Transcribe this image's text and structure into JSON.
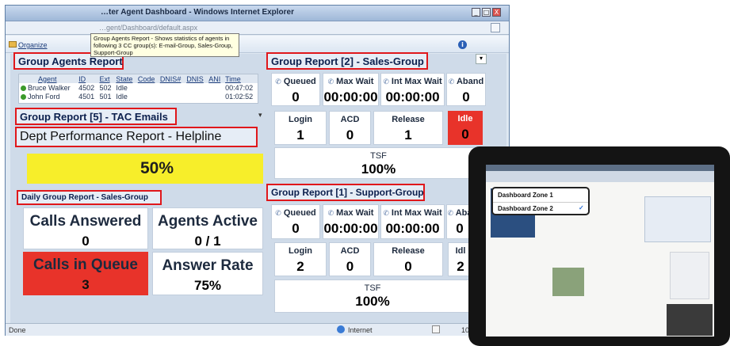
{
  "window": {
    "title": "…ter Agent Dashboard - Windows Internet Explorer",
    "url": "…gent/Dashboard/default.aspx",
    "min": "_",
    "max": "□",
    "close": "X"
  },
  "tooltip": "Group Agents Report - Shows statistics of agents in following 3 CC group(s): E-mail-Group, Sales-Group, Support-Group",
  "menu": {
    "organize": "Organize",
    "help": "i"
  },
  "agents_report": {
    "title": "Group Agents Report",
    "columns": [
      "Agent",
      "ID",
      "Ext",
      "State",
      "Code",
      "DNIS#",
      "DNIS",
      "ANI",
      "Time"
    ],
    "rows": [
      [
        "Bruce Walker",
        "4502",
        "502",
        "Idle",
        "",
        "",
        "",
        "",
        "00:47:02"
      ],
      [
        "John Ford",
        "4501",
        "501",
        "Idle",
        "",
        "",
        "",
        "",
        "01:02:52"
      ]
    ]
  },
  "tac_emails": {
    "title": "Group Report [5] - TAC Emails"
  },
  "dept_perf": {
    "title": "Dept Performance Report - Helpline",
    "value": "50%",
    "color": "#f7ee2a"
  },
  "daily_sales": {
    "title": "Daily Group Report - Sales-Group",
    "calls_answered": {
      "label": "Calls Answered",
      "value": "0"
    },
    "agents_active": {
      "label": "Agents Active",
      "value": "0 / 1"
    },
    "calls_in_queue": {
      "label": "Calls in Queue",
      "value": "3",
      "color": "#e8332a"
    },
    "answer_rate": {
      "label": "Answer Rate",
      "value": "75%"
    }
  },
  "sales_group": {
    "title": "Group Report [2] - Sales-Group",
    "queued": {
      "label": "Queued",
      "value": "0"
    },
    "max_wait": {
      "label": "Max Wait",
      "value": "00:00:00"
    },
    "int_max_wait": {
      "label": "Int Max Wait",
      "value": "00:00:00"
    },
    "aband": {
      "label": "Aband",
      "value": "0"
    },
    "login": {
      "label": "Login",
      "value": "1"
    },
    "acd": {
      "label": "ACD",
      "value": "0"
    },
    "release": {
      "label": "Release",
      "value": "1"
    },
    "idle": {
      "label": "Idle",
      "value": "0",
      "color": "#e8332a"
    },
    "tsf": {
      "label": "TSF",
      "value": "100%"
    }
  },
  "support_group": {
    "title": "Group Report [1] - Support-Group",
    "queued": {
      "label": "Queued",
      "value": "0"
    },
    "max_wait": {
      "label": "Max Wait",
      "value": "00:00:00"
    },
    "int_max_wait": {
      "label": "Int Max Wait",
      "value": "00:00:00"
    },
    "aband": {
      "label": "Aba",
      "value": "0"
    },
    "login": {
      "label": "Login",
      "value": "2"
    },
    "acd": {
      "label": "ACD",
      "value": "0"
    },
    "release": {
      "label": "Release",
      "value": "0"
    },
    "idle": {
      "label": "Idl",
      "value": "2"
    },
    "tsf": {
      "label": "TSF",
      "value": "100%"
    }
  },
  "status": {
    "left": "Done",
    "zone": "Internet",
    "zoom": "10"
  },
  "tablet": {
    "zones": [
      "Dashboard Zone 1",
      "Dashboard Zone 2"
    ],
    "selected_zone": "Dashboard Zone 2",
    "check": "✓"
  },
  "colors": {
    "header_red": "#e0171b",
    "accent_blue": "#1c3c7a"
  }
}
